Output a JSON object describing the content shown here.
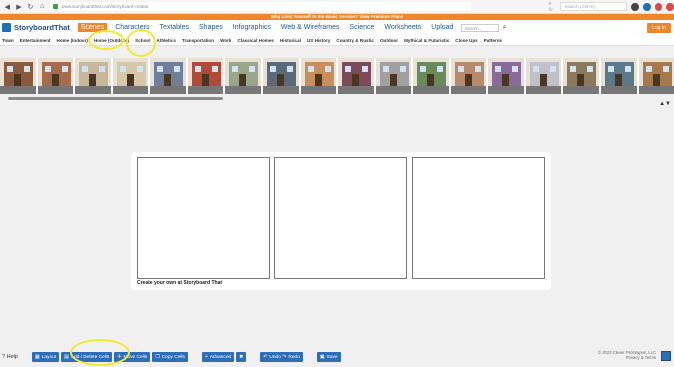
{
  "browser": {
    "url": "www.storyboardthat.com/storyboard-creator",
    "search_placeholder": "Search (Ctrl+K)"
  },
  "promo": {
    "text": "Why Limit Yourself to the Basic Version? View Premium Plans"
  },
  "header": {
    "logo": "StoryboardThat",
    "nav": [
      "Scenes",
      "Characters",
      "Textables",
      "Shapes",
      "Infographics",
      "Web & Wireframes",
      "Science",
      "Worksheets",
      "Upload"
    ],
    "search_placeholder": "Search...",
    "login": "Log In"
  },
  "categories": [
    "Town",
    "Entertainment",
    "Home (Indoor)",
    "Home (Outdoor)",
    "School",
    "Athletics",
    "Transportation",
    "Work",
    "Classical Homes",
    "Historical",
    "US History",
    "Country & Rustic",
    "Outdoor",
    "Mythical & Futuristic",
    "Close Ups",
    "Patterns"
  ],
  "board": {
    "caption": "Create your own at Storyboard That"
  },
  "toolbar": {
    "help": "Help",
    "buttons": [
      {
        "label": "Layout",
        "icon": "layout-icon"
      },
      {
        "label": "Add / Delete Cells",
        "icon": "grid-icon"
      },
      {
        "label": "Move Cells",
        "icon": "move-icon"
      },
      {
        "label": "Copy Cells",
        "icon": "copy-icon"
      },
      {
        "label": "Advanced",
        "icon": "plus-icon"
      },
      {
        "label": "",
        "icon": "close-icon"
      },
      {
        "label": "Undo",
        "icon": "undo-icon"
      },
      {
        "label": "Redo",
        "icon": "redo-icon"
      },
      {
        "label": "Save",
        "icon": "save-icon"
      }
    ],
    "copyright_1": "© 2023 Clever Prototypes, LLC",
    "copyright_2": "Privacy & Terms"
  },
  "colors": {
    "accent": "#f0862a",
    "primary": "#2e6db7",
    "annotation": "#f2ea2b"
  }
}
